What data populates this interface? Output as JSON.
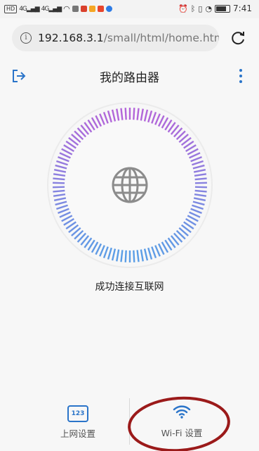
{
  "status_bar": {
    "left_chips": [
      "HD",
      "4G",
      "4G"
    ],
    "time": "7:41",
    "colors": {
      "app1": "#d9402c",
      "app2": "#f5a623",
      "app3": "#e8452c",
      "app4": "#2d7be5"
    }
  },
  "browser": {
    "url_host": "192.168.3.1",
    "url_path": "/small/html/home.htm",
    "info_icon": "info-icon",
    "reload_icon": "reload-icon"
  },
  "header": {
    "title": "我的路由器",
    "back_icon": "exit-icon",
    "menu_icon": "more-vertical-icon"
  },
  "main": {
    "status": "成功连接互联网",
    "center_icon": "globe-icon",
    "ring_colors": {
      "top": "#b366d9",
      "bottom": "#5b9ee6"
    }
  },
  "bottom_nav": {
    "items": [
      {
        "label": "上网设置",
        "icon": "internet-settings-icon",
        "icon_text": "123"
      },
      {
        "label": "Wi-Fi 设置",
        "icon": "wifi-icon"
      }
    ],
    "accent": "#2a74c9",
    "annotation_color": "#9b1a1a"
  }
}
